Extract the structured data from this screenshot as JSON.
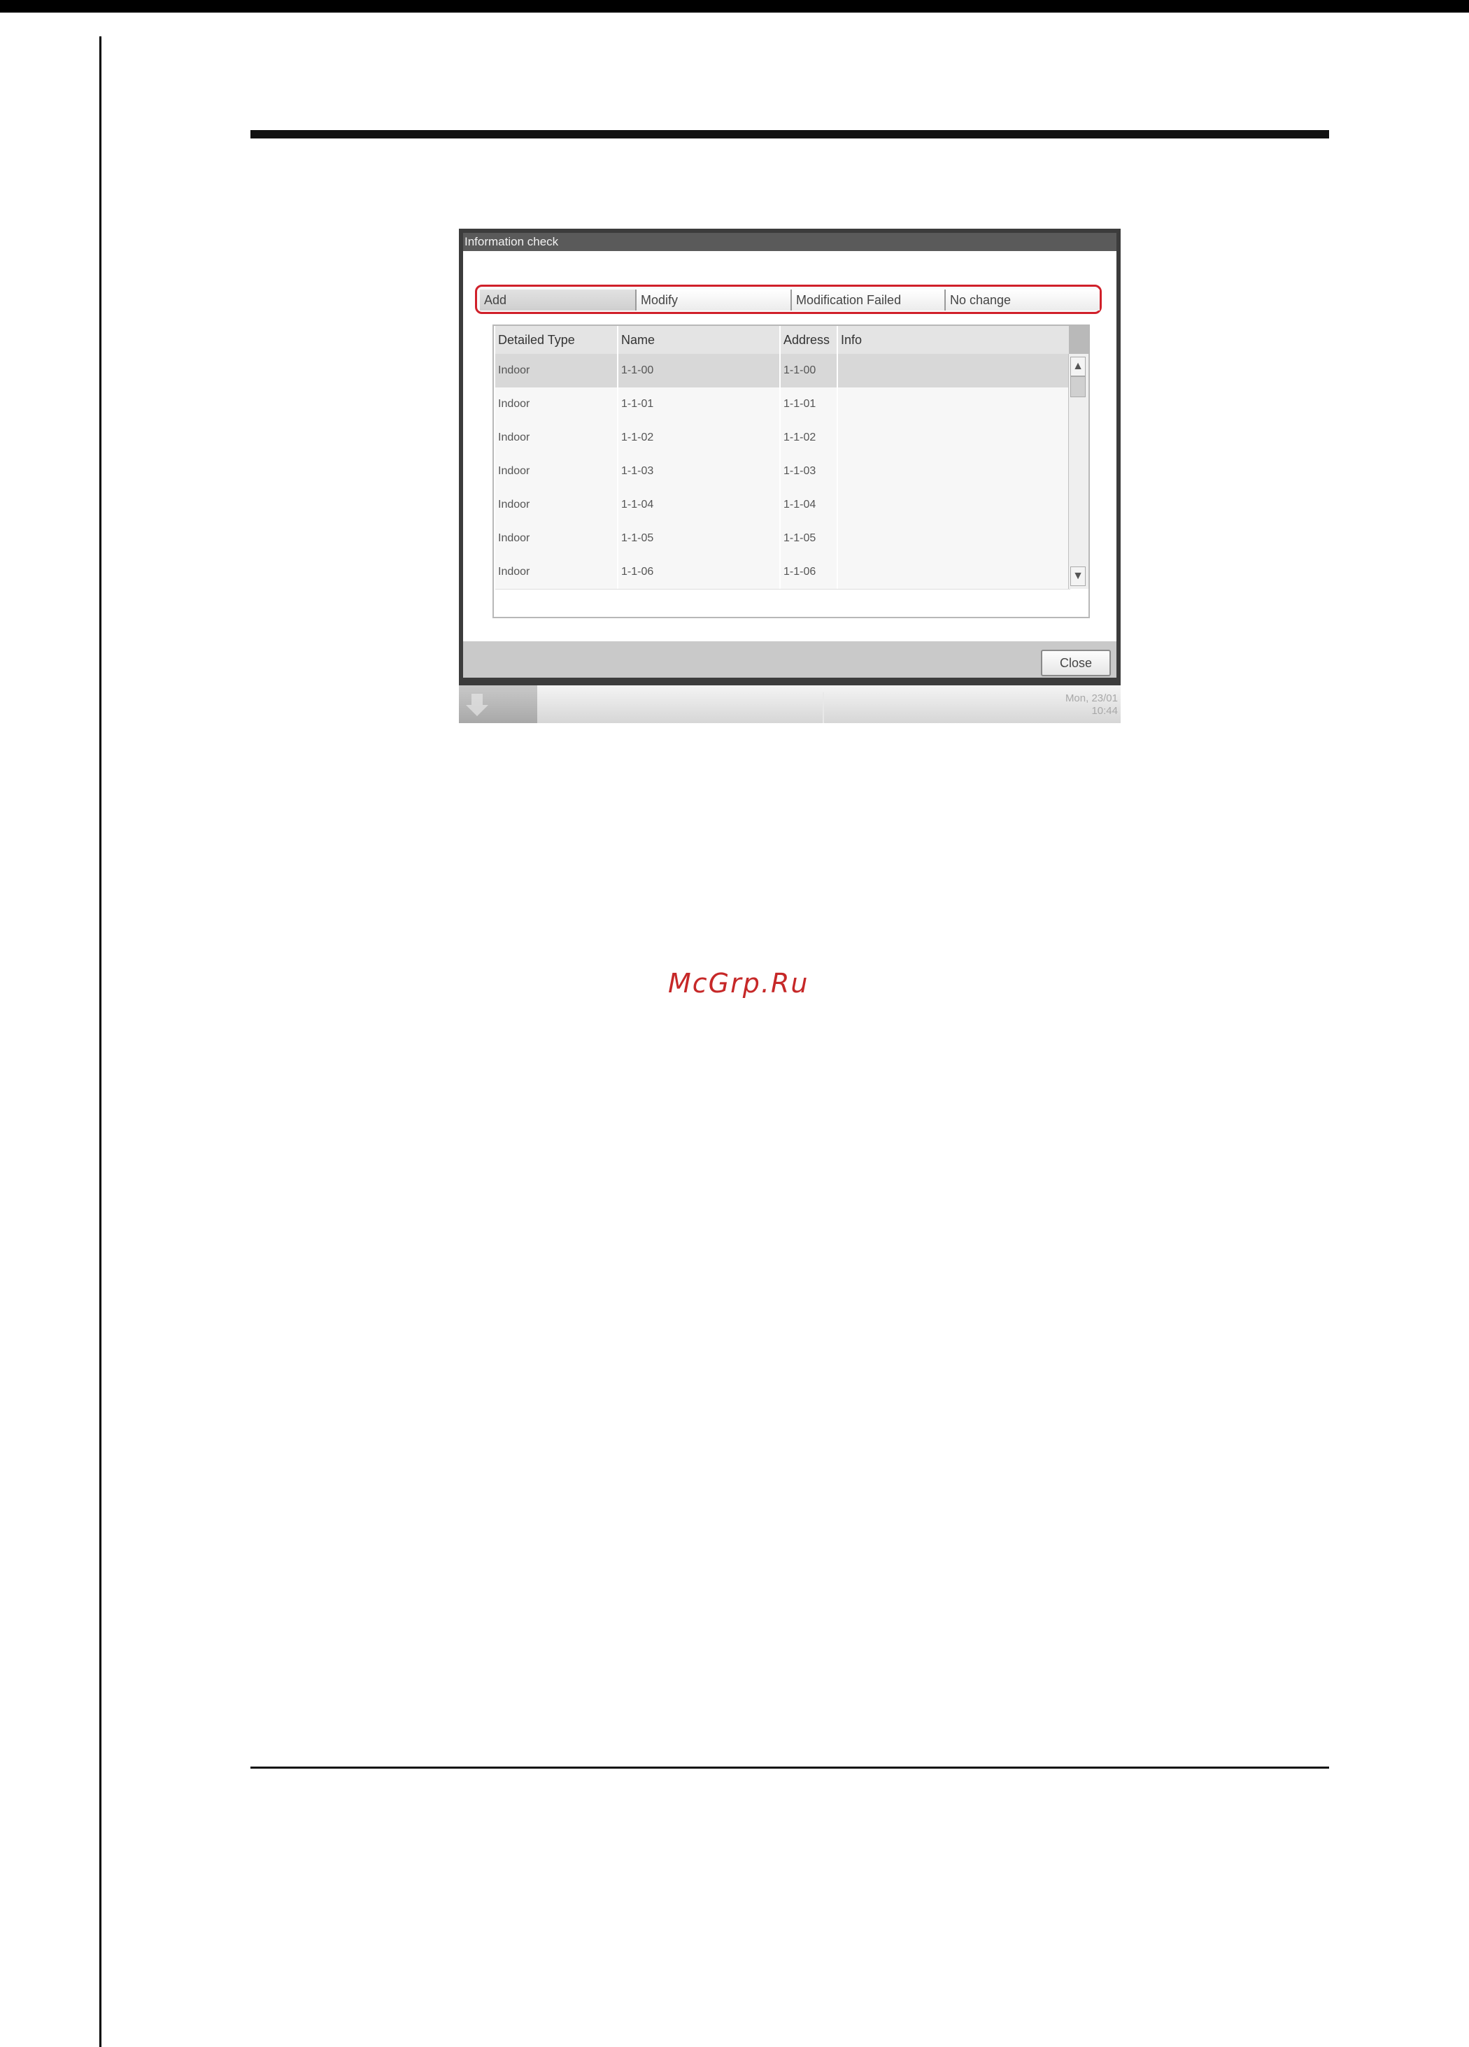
{
  "watermark": "McGrp.Ru",
  "window": {
    "title": "Information check",
    "tabs": [
      {
        "label": "Add",
        "active": true
      },
      {
        "label": "Modify",
        "active": false
      },
      {
        "label": "Modification Failed",
        "active": false
      },
      {
        "label": "No change",
        "active": false
      }
    ],
    "columns": [
      "Detailed Type",
      "Name",
      "Address",
      "Info"
    ],
    "rows": [
      {
        "type": "Indoor",
        "name": "1-1-00",
        "address": "1-1-00",
        "info": "",
        "selected": true
      },
      {
        "type": "Indoor",
        "name": "1-1-01",
        "address": "1-1-01",
        "info": ""
      },
      {
        "type": "Indoor",
        "name": "1-1-02",
        "address": "1-1-02",
        "info": ""
      },
      {
        "type": "Indoor",
        "name": "1-1-03",
        "address": "1-1-03",
        "info": ""
      },
      {
        "type": "Indoor",
        "name": "1-1-04",
        "address": "1-1-04",
        "info": ""
      },
      {
        "type": "Indoor",
        "name": "1-1-05",
        "address": "1-1-05",
        "info": ""
      },
      {
        "type": "Indoor",
        "name": "1-1-06",
        "address": "1-1-06",
        "info": ""
      }
    ],
    "close_label": "Close"
  },
  "taskbar": {
    "date": "Mon, 23/01",
    "time": "10:44"
  },
  "colors": {
    "highlight": "#d0202a",
    "watermark": "#c62828"
  },
  "icons": {
    "scroll_up": "▲",
    "scroll_down": "▼"
  }
}
